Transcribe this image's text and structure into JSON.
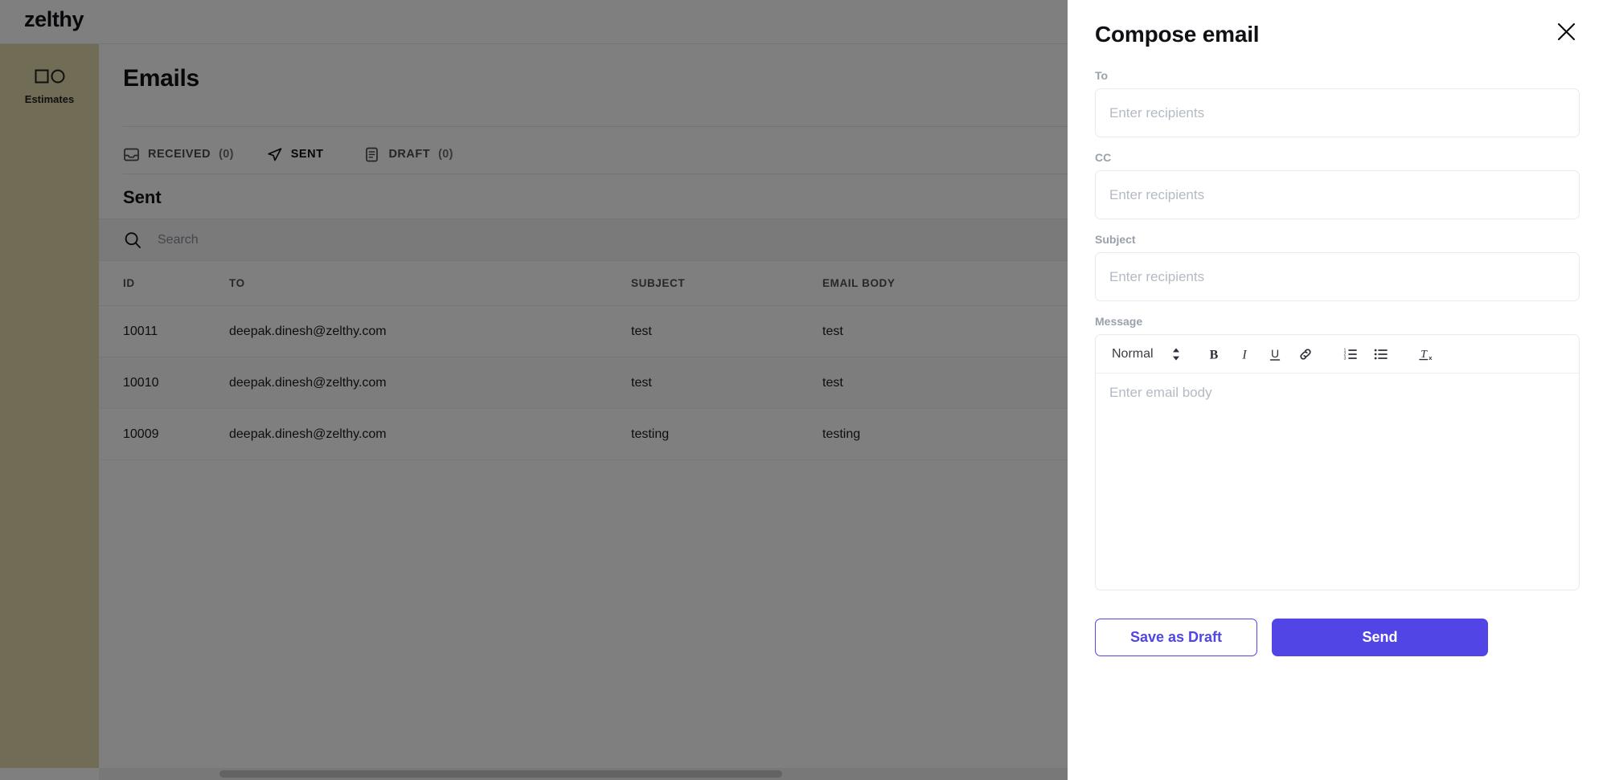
{
  "app": {
    "brand": "zelthy",
    "accent_color": "#5146e5",
    "sidebar_color": "#e0d8ad"
  },
  "sidebar": {
    "items": [
      {
        "label": "Estimates",
        "icon": "square-circle-icon"
      }
    ]
  },
  "main": {
    "page_title": "Emails",
    "tabs": [
      {
        "label": "RECEIVED",
        "count": "(0)",
        "icon": "inbox-icon",
        "active": false
      },
      {
        "label": "SENT",
        "count": "",
        "icon": "send-icon",
        "active": true
      },
      {
        "label": "DRAFT",
        "count": "(0)",
        "icon": "document-icon",
        "active": false
      }
    ],
    "section_title": "Sent",
    "search": {
      "placeholder": "Search",
      "value": "",
      "icon": "search-icon"
    },
    "table": {
      "columns": [
        "ID",
        "TO",
        "SUBJECT",
        "EMAIL BODY"
      ],
      "rows": [
        {
          "id": "10011",
          "to": "deepak.dinesh@zelthy.com",
          "subject": "test",
          "body": "test"
        },
        {
          "id": "10010",
          "to": "deepak.dinesh@zelthy.com",
          "subject": "test",
          "body": "test"
        },
        {
          "id": "10009",
          "to": "deepak.dinesh@zelthy.com",
          "subject": "testing",
          "body": "testing"
        }
      ]
    }
  },
  "drawer": {
    "title": "Compose email",
    "close_icon": "close-icon",
    "fields": {
      "to": {
        "label": "To",
        "placeholder": "Enter recipients",
        "value": ""
      },
      "cc": {
        "label": "CC",
        "placeholder": "Enter recipients",
        "value": ""
      },
      "subject": {
        "label": "Subject",
        "placeholder": "Enter recipients",
        "value": ""
      },
      "message": {
        "label": "Message",
        "placeholder": "Enter email body",
        "value": ""
      }
    },
    "editor_toolbar": {
      "format_select": "Normal",
      "buttons": [
        {
          "name": "bold",
          "glyph": "B"
        },
        {
          "name": "italic",
          "glyph": "I"
        },
        {
          "name": "underline",
          "glyph": "U"
        },
        {
          "name": "link",
          "glyph": "link"
        },
        {
          "name": "ordered-list",
          "glyph": "1."
        },
        {
          "name": "bullet-list",
          "glyph": "•"
        },
        {
          "name": "clear-format",
          "glyph": "Tx"
        }
      ]
    },
    "actions": {
      "save_draft": "Save as Draft",
      "send": "Send"
    }
  }
}
